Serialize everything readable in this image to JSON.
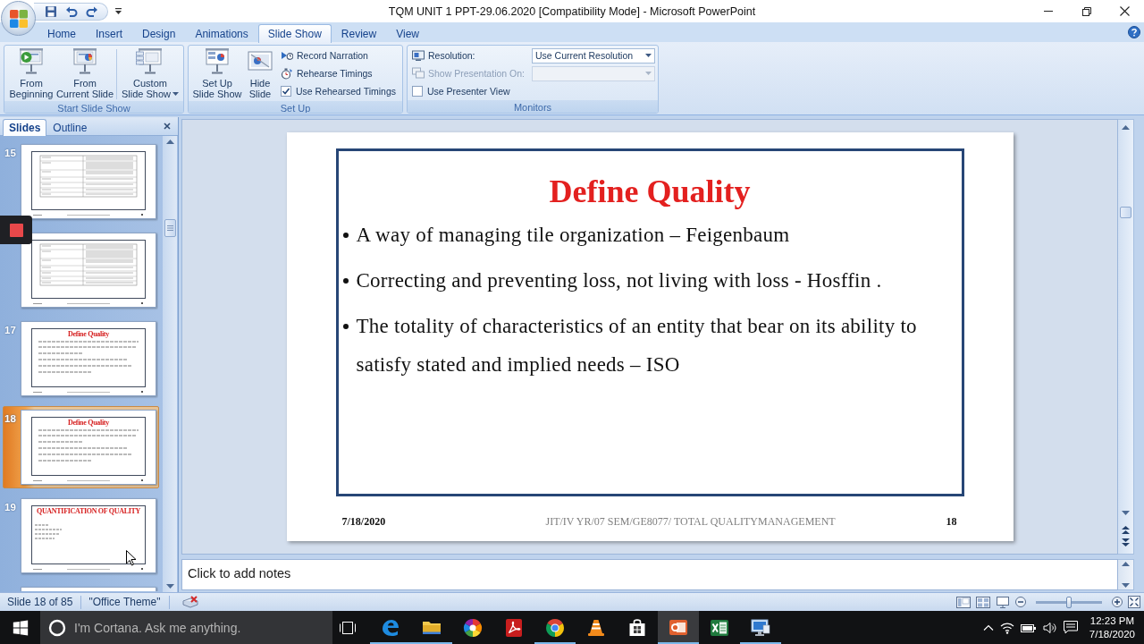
{
  "window": {
    "title": "TQM UNIT 1 PPT-29.06.2020 [Compatibility Mode] - Microsoft PowerPoint"
  },
  "ribbon": {
    "tabs": [
      {
        "label": "Home",
        "selected": false
      },
      {
        "label": "Insert",
        "selected": false
      },
      {
        "label": "Design",
        "selected": false
      },
      {
        "label": "Animations",
        "selected": false
      },
      {
        "label": "Slide Show",
        "selected": true
      },
      {
        "label": "Review",
        "selected": false
      },
      {
        "label": "View",
        "selected": false
      }
    ],
    "groups": [
      {
        "label": "Start Slide Show",
        "buttons": [
          {
            "kind": "beginning",
            "lines": [
              "From",
              "Beginning"
            ]
          },
          {
            "kind": "current",
            "lines": [
              "From",
              "Current Slide"
            ]
          },
          {
            "kind": "custom",
            "lines": [
              "Custom",
              "Slide Show"
            ]
          }
        ]
      },
      {
        "label": "Set Up",
        "buttons": [
          {
            "kind": "setup",
            "lines": [
              "Set Up",
              "Slide Show"
            ]
          },
          {
            "kind": "hide",
            "lines": [
              "Hide",
              "Slide"
            ]
          }
        ],
        "options": [
          {
            "kind": "narration",
            "label": "Record Narration"
          },
          {
            "kind": "timings",
            "label": "Rehearse Timings"
          },
          {
            "kind": "checkbox",
            "label": "Use Rehearsed Timings",
            "checked": true
          }
        ]
      },
      {
        "label": "Monitors",
        "options": [
          {
            "kind": "resolution",
            "label": "Resolution:",
            "value": "Use Current Resolution",
            "disabled": false
          },
          {
            "kind": "display",
            "label": "Show Presentation On:",
            "disabled": true
          },
          {
            "kind": "checkbox",
            "label": "Use Presenter View",
            "checked": false
          }
        ]
      }
    ]
  },
  "slides_panel": {
    "tabs": [
      {
        "label": "Slides",
        "selected": true
      },
      {
        "label": "Outline",
        "selected": false
      }
    ],
    "thumbnails": [
      {
        "number": "15",
        "kind": "table",
        "selected": false
      },
      {
        "kind": "table",
        "selected": false
      },
      {
        "number": "17",
        "kind": "bullets",
        "title": "Define Quality",
        "selected": false
      },
      {
        "number": "18",
        "kind": "bullets",
        "title": "Define Quality",
        "selected": true
      },
      {
        "number": "19",
        "kind": "formula",
        "title": "QUANTIFICATION OF QUALITY",
        "selected": false
      },
      {
        "kind": "blank",
        "selected": false
      }
    ]
  },
  "slide": {
    "title": "Define Quality",
    "bullets": [
      "A way of managing tile organization – Feigenbaum",
      "Correcting and preventing loss, not living with loss - Hosffin .",
      "The totality of characteristics of an entity that bear on its ability to satisfy stated and implied needs – ISO"
    ],
    "footer": {
      "date": "7/18/2020",
      "text": "JIT/IV YR/07 SEM/GE8077/ TOTAL QUALITYMANAGEMENT",
      "number": "18"
    }
  },
  "notes": {
    "placeholder": "Click to add notes"
  },
  "status_bar": {
    "slide_info": "Slide 18 of 85",
    "theme": "\"Office Theme\"",
    "zoom": {
      "level": 0.5
    }
  },
  "taskbar": {
    "search": {
      "placeholder": "I'm Cortana. Ask me anything."
    },
    "apps": [
      {
        "kind": "edge",
        "running": true,
        "selected": false
      },
      {
        "kind": "explorer",
        "running": true,
        "selected": false
      },
      {
        "kind": "photos",
        "running": false,
        "selected": false
      },
      {
        "kind": "acrobat",
        "running": false,
        "selected": false
      },
      {
        "kind": "chrome",
        "running": true,
        "selected": false
      },
      {
        "kind": "vlc",
        "running": false,
        "selected": false
      },
      {
        "kind": "store",
        "running": false,
        "selected": false
      },
      {
        "kind": "powerpoint",
        "running": true,
        "selected": true
      },
      {
        "kind": "excel",
        "running": false,
        "selected": false
      },
      {
        "kind": "remote",
        "running": true,
        "selected": false
      }
    ],
    "clock": {
      "time": "12:23 PM",
      "date": "7/18/2020"
    }
  }
}
